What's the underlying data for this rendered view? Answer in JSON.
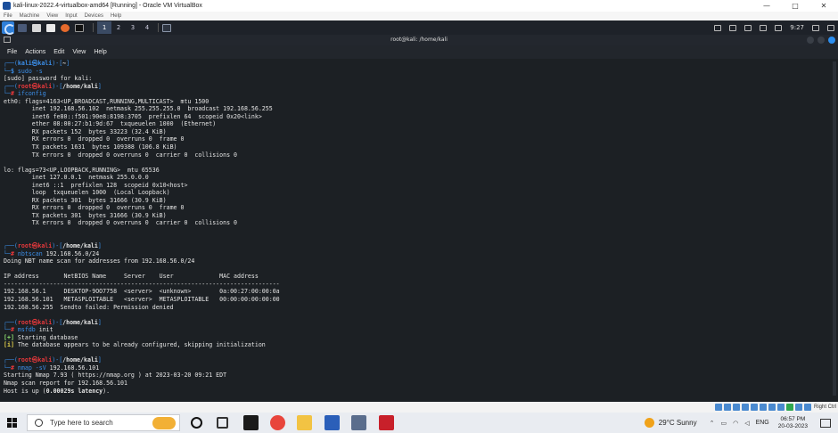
{
  "vbox": {
    "title": "kali-linux-2022.4-virtualbox-amd64 [Running] - Oracle VM VirtualBox",
    "menu": [
      "File",
      "Machine",
      "View",
      "Input",
      "Devices",
      "Help"
    ],
    "status_label": "Right Ctrl"
  },
  "panel": {
    "workspaces": [
      "1",
      "2",
      "3",
      "4"
    ],
    "time": "9:27"
  },
  "terminal": {
    "title": "root@kali: /home/kali",
    "menu": [
      "File",
      "Actions",
      "Edit",
      "View",
      "Help"
    ],
    "lines": [
      [
        {
          "t": "┌──(",
          "c": "blue"
        },
        {
          "t": "kali㉿kali",
          "c": "blue bold"
        },
        {
          "t": ")-[",
          "c": "blue"
        },
        {
          "t": "~",
          "c": "bold"
        },
        {
          "t": "]",
          "c": "blue"
        }
      ],
      [
        {
          "t": "└─",
          "c": "blue"
        },
        {
          "t": "$ ",
          "c": "blue bold"
        },
        {
          "t": "sudo -s",
          "c": "blue"
        }
      ],
      [
        {
          "t": "[sudo] password for kali:"
        }
      ],
      [
        {
          "t": "┌──(",
          "c": "blue"
        },
        {
          "t": "root㉿kali",
          "c": "red bold"
        },
        {
          "t": ")-[",
          "c": "blue"
        },
        {
          "t": "/home/kali",
          "c": "bold"
        },
        {
          "t": "]",
          "c": "blue"
        }
      ],
      [
        {
          "t": "└─",
          "c": "blue"
        },
        {
          "t": "# ",
          "c": "red bold"
        },
        {
          "t": "ifconfig",
          "c": "blue"
        }
      ],
      [
        {
          "t": "eth0: flags=4163<UP,BROADCAST,RUNNING,MULTICAST>  mtu 1500"
        }
      ],
      [
        {
          "t": "        inet 192.168.56.102  netmask 255.255.255.0  broadcast 192.168.56.255"
        }
      ],
      [
        {
          "t": "        inet6 fe80::f501:90e8:8198:3705  prefixlen 64  scopeid 0x20<link>"
        }
      ],
      [
        {
          "t": "        ether 08:00:27:b1:9d:67  txqueuelen 1000  (Ethernet)"
        }
      ],
      [
        {
          "t": "        RX packets 152  bytes 33223 (32.4 KiB)"
        }
      ],
      [
        {
          "t": "        RX errors 0  dropped 0  overruns 0  frame 0"
        }
      ],
      [
        {
          "t": "        TX packets 1631  bytes 109388 (106.8 KiB)"
        }
      ],
      [
        {
          "t": "        TX errors 0  dropped 0 overruns 0  carrier 0  collisions 0"
        }
      ],
      [
        {
          "t": ""
        }
      ],
      [
        {
          "t": "lo: flags=73<UP,LOOPBACK,RUNNING>  mtu 65536"
        }
      ],
      [
        {
          "t": "        inet 127.0.0.1  netmask 255.0.0.0"
        }
      ],
      [
        {
          "t": "        inet6 ::1  prefixlen 128  scopeid 0x10<host>"
        }
      ],
      [
        {
          "t": "        loop  txqueuelen 1000  (Local Loopback)"
        }
      ],
      [
        {
          "t": "        RX packets 301  bytes 31666 (30.9 KiB)"
        }
      ],
      [
        {
          "t": "        RX errors 0  dropped 0  overruns 0  frame 0"
        }
      ],
      [
        {
          "t": "        TX packets 301  bytes 31666 (30.9 KiB)"
        }
      ],
      [
        {
          "t": "        TX errors 0  dropped 0 overruns 0  carrier 0  collisions 0"
        }
      ],
      [
        {
          "t": ""
        }
      ],
      [
        {
          "t": ""
        }
      ],
      [
        {
          "t": "┌──(",
          "c": "blue"
        },
        {
          "t": "root㉿kali",
          "c": "red bold"
        },
        {
          "t": ")-[",
          "c": "blue"
        },
        {
          "t": "/home/kali",
          "c": "bold"
        },
        {
          "t": "]",
          "c": "blue"
        }
      ],
      [
        {
          "t": "└─",
          "c": "blue"
        },
        {
          "t": "# ",
          "c": "red bold"
        },
        {
          "t": "nbtscan",
          "c": "blue"
        },
        {
          "t": " 192.168.56.0/24"
        }
      ],
      [
        {
          "t": "Doing NBT name scan for addresses from 192.168.56.0/24"
        }
      ],
      [
        {
          "t": ""
        }
      ],
      [
        {
          "t": "IP address       NetBIOS Name     Server    User             MAC address"
        }
      ],
      [
        {
          "t": "------------------------------------------------------------------------------"
        }
      ],
      [
        {
          "t": "192.168.56.1     DESKTOP-9OO7758  <server>  <unknown>        0a:00:27:00:00:0a"
        }
      ],
      [
        {
          "t": "192.168.56.101   METASPLOITABLE   <server>  METASPLOITABLE   00:00:00:00:00:00"
        }
      ],
      [
        {
          "t": "192.168.56.255  Sendto failed: Permission denied"
        }
      ],
      [
        {
          "t": ""
        }
      ],
      [
        {
          "t": "┌──(",
          "c": "blue"
        },
        {
          "t": "root㉿kali",
          "c": "red bold"
        },
        {
          "t": ")-[",
          "c": "blue"
        },
        {
          "t": "/home/kali",
          "c": "bold"
        },
        {
          "t": "]",
          "c": "blue"
        }
      ],
      [
        {
          "t": "└─",
          "c": "blue"
        },
        {
          "t": "# ",
          "c": "red bold"
        },
        {
          "t": "msfdb",
          "c": "blue"
        },
        {
          "t": " init"
        }
      ],
      [
        {
          "t": "[+]",
          "c": "green bold"
        },
        {
          "t": " Starting database"
        }
      ],
      [
        {
          "t": "[i]",
          "c": "ylw bold"
        },
        {
          "t": " The database appears to be already configured, skipping initialization"
        }
      ],
      [
        {
          "t": ""
        }
      ],
      [
        {
          "t": "┌──(",
          "c": "blue"
        },
        {
          "t": "root㉿kali",
          "c": "red bold"
        },
        {
          "t": ")-[",
          "c": "blue"
        },
        {
          "t": "/home/kali",
          "c": "bold"
        },
        {
          "t": "]",
          "c": "blue"
        }
      ],
      [
        {
          "t": "└─",
          "c": "blue"
        },
        {
          "t": "# ",
          "c": "red bold"
        },
        {
          "t": "nmap -sV",
          "c": "blue"
        },
        {
          "t": " 192.168.56.101"
        }
      ],
      [
        {
          "t": "Starting Nmap 7.93 ( https://nmap.org ) at 2023-03-20 09:21 EDT"
        }
      ],
      [
        {
          "t": "Nmap scan report for 192.168.56.101"
        }
      ],
      [
        {
          "t": "Host is up ("
        },
        {
          "t": "0.00029s latency",
          "c": "bold"
        },
        {
          "t": ")."
        }
      ]
    ]
  },
  "taskbar": {
    "search_placeholder": "Type here to search",
    "weather": "29°C  Sunny",
    "language": "ENG",
    "time": "06:57 PM",
    "date": "20-03-2023"
  }
}
